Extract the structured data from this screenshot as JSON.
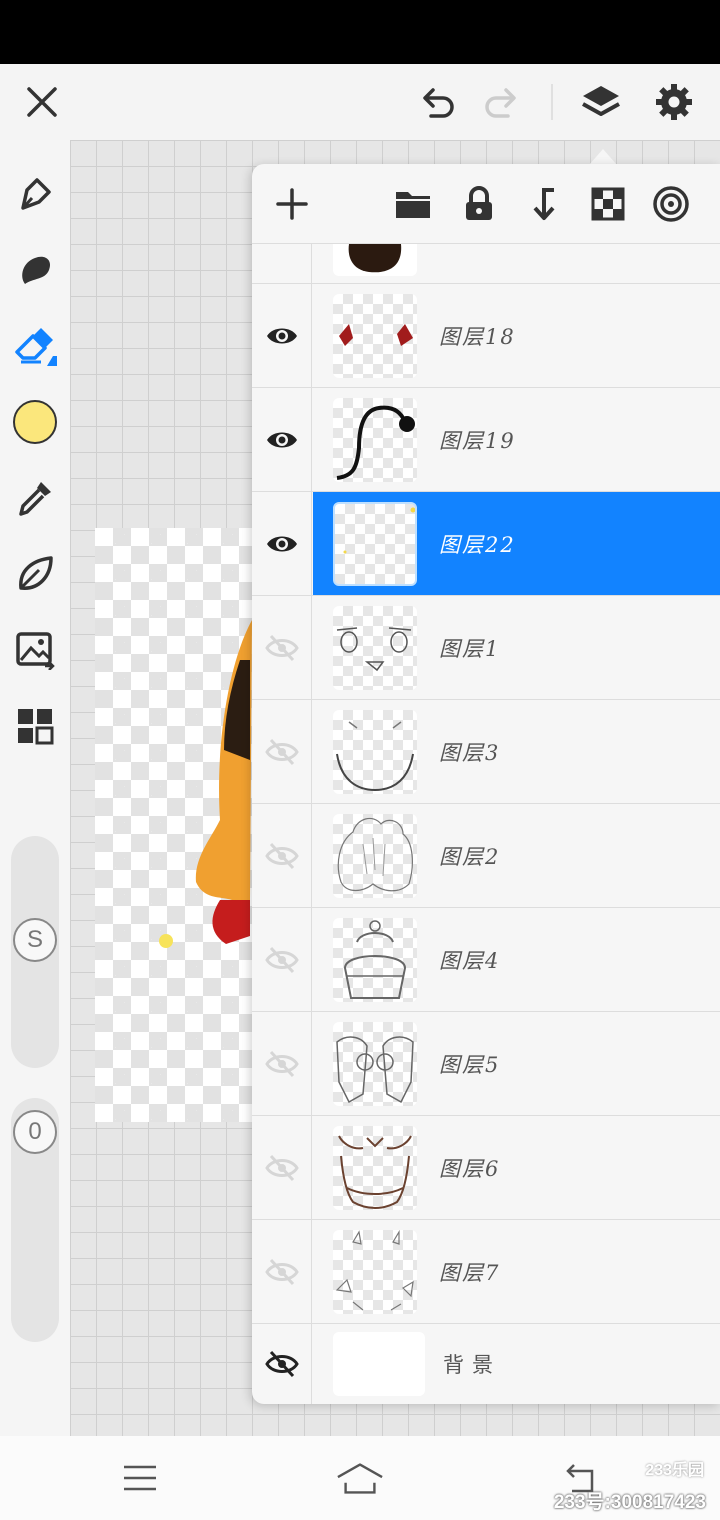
{
  "app": {
    "top_bar": {
      "close_icon": "close-icon",
      "undo_icon": "undo-icon",
      "redo_icon": "redo-icon",
      "layers_icon": "layers-icon",
      "settings_icon": "gear-icon"
    },
    "tools": [
      {
        "name": "pen-icon"
      },
      {
        "name": "smudge-icon"
      },
      {
        "name": "eraser-icon",
        "active": true
      },
      {
        "name": "color-swatch",
        "color": "#fbe77c"
      },
      {
        "name": "eyedropper-icon"
      },
      {
        "name": "leaf-icon"
      },
      {
        "name": "image-import-icon"
      },
      {
        "name": "grid-menu-icon"
      }
    ],
    "brush_size_label": "S",
    "opacity_label": "0",
    "accent_color": "#1283ff"
  },
  "layers_panel": {
    "toolbar": [
      "add-layer-icon",
      "folder-icon",
      "lock-icon",
      "merge-down-icon",
      "checker-icon",
      "clipping-icon"
    ],
    "layers": [
      {
        "label": "",
        "visible": null
      },
      {
        "label": "图层18",
        "visible": true
      },
      {
        "label": "图层19",
        "visible": true
      },
      {
        "label": "图层22",
        "visible": true,
        "selected": true
      },
      {
        "label": "图层1",
        "visible": false
      },
      {
        "label": "图层3",
        "visible": false
      },
      {
        "label": "图层2",
        "visible": false
      },
      {
        "label": "图层4",
        "visible": false
      },
      {
        "label": "图层5",
        "visible": false
      },
      {
        "label": "图层6",
        "visible": false
      },
      {
        "label": "图层7",
        "visible": false
      },
      {
        "label": "背景",
        "visible": false
      }
    ]
  },
  "watermark": {
    "logo": "233乐园",
    "id_text": "233号:300817423"
  }
}
